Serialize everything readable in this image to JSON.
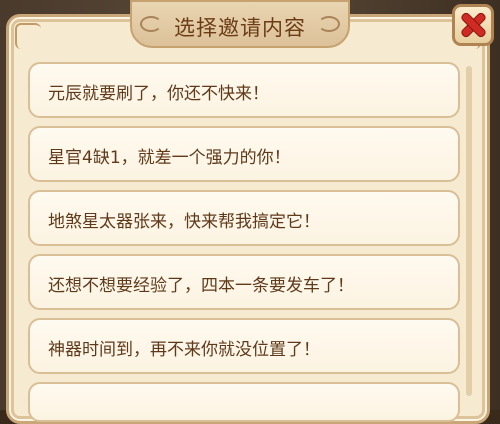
{
  "dialog": {
    "title": "选择邀请内容",
    "close_icon": "close-x-icon"
  },
  "items": [
    {
      "label": "元辰就要刷了，你还不快来！"
    },
    {
      "label": "星官4缺1，就差一个强力的你！"
    },
    {
      "label": "地煞星太器张来，快来帮我搞定它！"
    },
    {
      "label": "还想不想要经验了，四本一条要发车了！"
    },
    {
      "label": "神器时间到，再不来你就没位置了！"
    },
    {
      "label": ""
    }
  ],
  "colors": {
    "accent_close": "#cf2b22",
    "text": "#5e3a1a",
    "title": "#6b3c16",
    "panel": "#f6ead0"
  }
}
